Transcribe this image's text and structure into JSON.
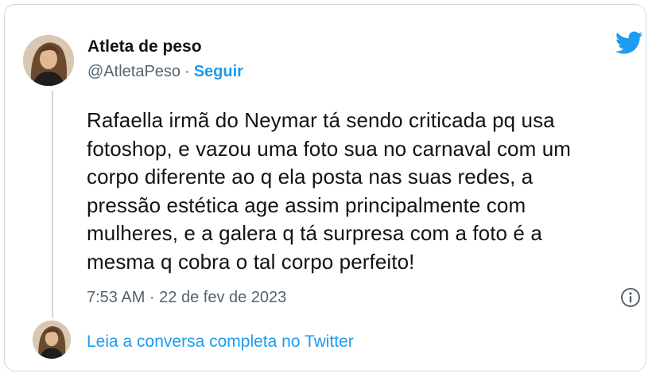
{
  "author": {
    "name": "Atleta de peso",
    "handle": "@AtletaPeso",
    "separator": "·",
    "follow_label": "Seguir"
  },
  "tweet": {
    "lines": [
      "Rafaella irmã do Neymar tá sendo criticada pq usa",
      "fotoshop, e vazou uma foto sua no carnaval com um",
      "corpo diferente ao q ela posta nas suas redes, a",
      "pressão estética age assim principalmente com",
      "mulheres, e a galera q tá surpresa com a foto é a",
      "mesma q cobra o tal corpo perfeito!"
    ],
    "timestamp": "7:53 AM · 22 de fev de 2023"
  },
  "footer": {
    "read_more": "Leia a conversa completa no Twitter"
  },
  "icons": {
    "brand": "twitter-bird-icon",
    "info": "info-icon"
  },
  "colors": {
    "accent": "#1d9bf0",
    "text": "#0f1419",
    "muted": "#536471",
    "border": "#cfd9de"
  }
}
